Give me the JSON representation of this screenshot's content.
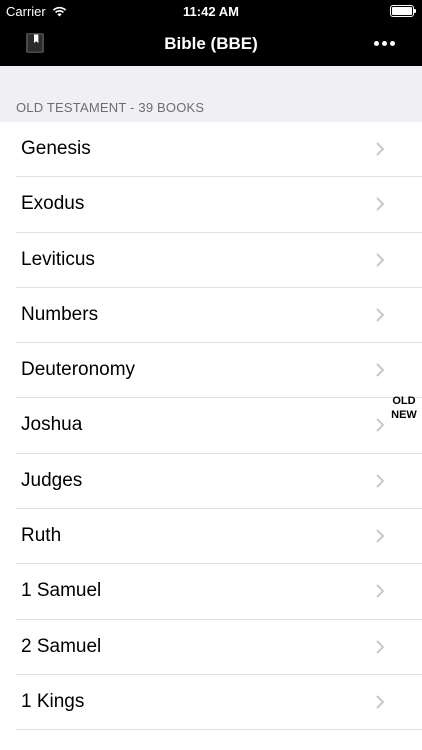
{
  "status_bar": {
    "carrier": "Carrier",
    "time": "11:42 AM"
  },
  "nav": {
    "title": "Bible (BBE)"
  },
  "section": {
    "header": "OLD TESTAMENT - 39 BOOKS"
  },
  "books": [
    "Genesis",
    "Exodus",
    "Leviticus",
    "Numbers",
    "Deuteronomy",
    "Joshua",
    "Judges",
    "Ruth",
    "1 Samuel",
    "2 Samuel",
    "1 Kings"
  ],
  "index": [
    "OLD",
    "NEW"
  ],
  "icons": {
    "wifi": "wifi-icon",
    "battery": "battery-icon",
    "bookmark": "bookmark-book-icon",
    "more": "more-icon",
    "chevron": "chevron-right-icon"
  },
  "colors": {
    "bar": "#000000",
    "section_bg": "#efeff4",
    "section_text": "#6d6d72",
    "chevron": "#c7c7cc"
  }
}
